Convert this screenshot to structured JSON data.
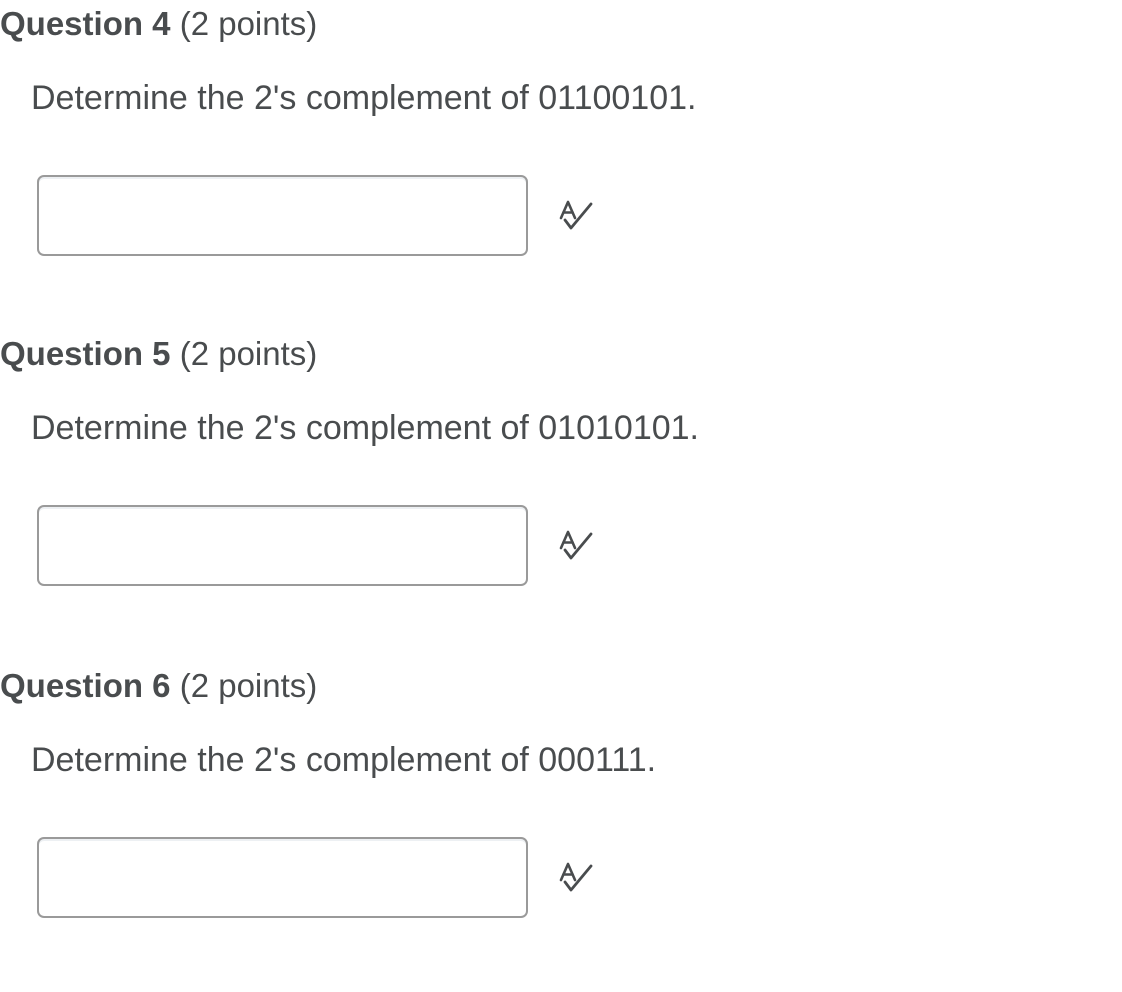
{
  "questions": [
    {
      "title": "Question 4",
      "points": "(2 points)",
      "prompt": "Determine the 2's complement of 01100101.",
      "answer_value": "",
      "answer_placeholder": "",
      "spellcheck_icon": "spellcheck-icon"
    },
    {
      "title": "Question 5",
      "points": "(2 points)",
      "prompt": "Determine the 2's complement of 01010101.",
      "answer_value": "",
      "answer_placeholder": "",
      "spellcheck_icon": "spellcheck-icon"
    },
    {
      "title": "Question 6",
      "points": "(2 points)",
      "prompt": "Determine the 2's complement of 000111.",
      "answer_value": "",
      "answer_placeholder": "",
      "spellcheck_icon": "spellcheck-icon"
    }
  ],
  "colors": {
    "text": "#494c4e",
    "input_border": "#9a9a9a",
    "background": "#ffffff"
  }
}
